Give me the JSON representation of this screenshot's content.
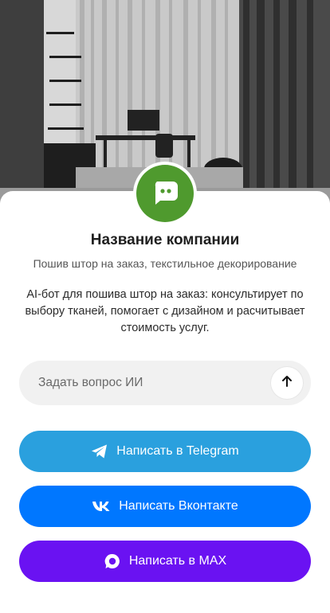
{
  "company": {
    "name": "Название компании",
    "tagline": "Пошив штор на заказ, текстильное декорирование",
    "description": "AI-бот для пошива штор на заказ: консультирует по выбору тканей, помогает с дизайном и расчитывает стоимость услуг."
  },
  "ask": {
    "placeholder": "Задать вопрос ИИ"
  },
  "buttons": {
    "telegram": "Написать в Telegram",
    "vk": "Написать Вконтакте",
    "max": "Написать в MAX"
  },
  "colors": {
    "avatar": "#4f9a2e",
    "telegram": "#2aa0de",
    "vk": "#0077ff",
    "max": "#6a12f2"
  },
  "icons": [
    "chat-bot-icon",
    "arrow-up-icon",
    "telegram-icon",
    "vk-icon",
    "max-icon"
  ]
}
